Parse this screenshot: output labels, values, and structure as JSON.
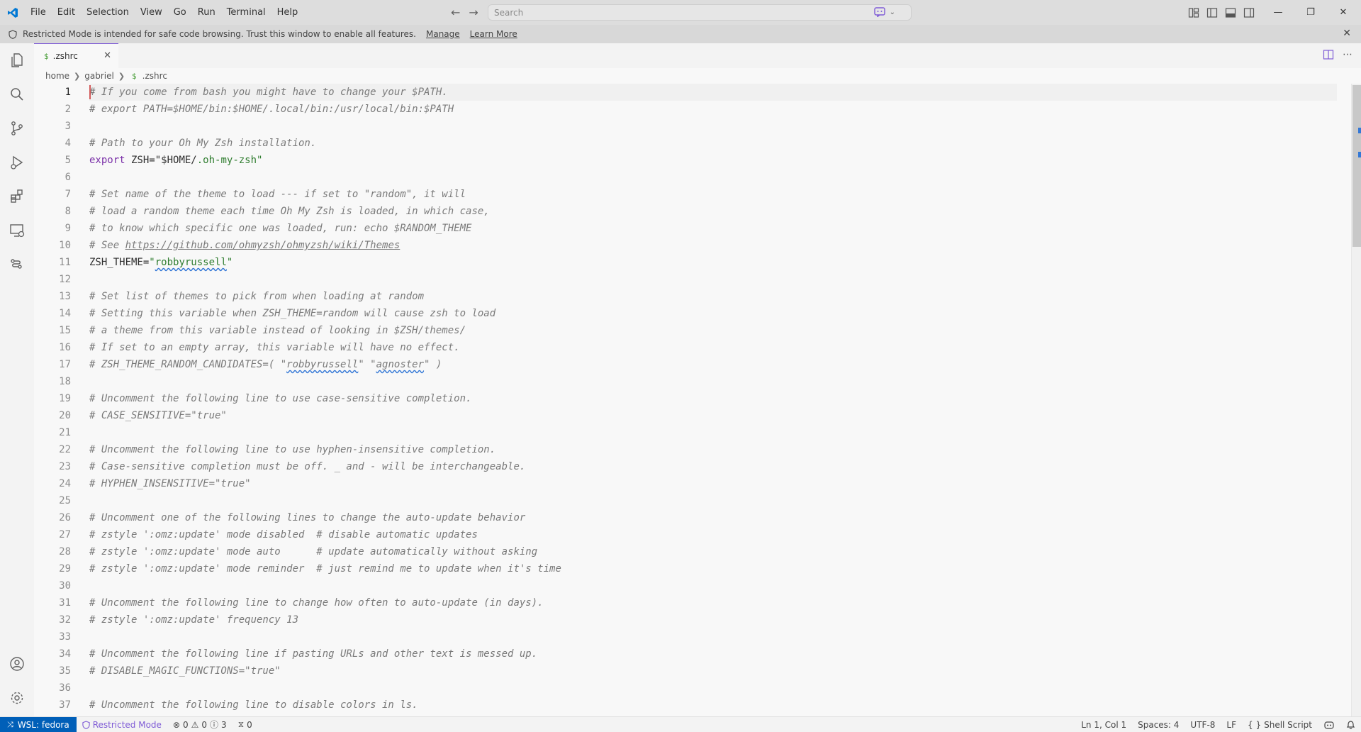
{
  "menu": [
    "File",
    "Edit",
    "Selection",
    "View",
    "Go",
    "Run",
    "Terminal",
    "Help"
  ],
  "search": {
    "placeholder": "Search"
  },
  "banner": {
    "message": "Restricted Mode is intended for safe code browsing. Trust this window to enable all features.",
    "manage": "Manage",
    "learn_more": "Learn More"
  },
  "tab": {
    "icon": "$",
    "label": ".zshrc"
  },
  "breadcrumb": {
    "home": "home",
    "user": "gabriel",
    "file_icon": "$",
    "file": ".zshrc"
  },
  "editor": {
    "lines": [
      [
        {
          "t": "cm",
          "v": "# If you come from bash you might have to change your $PATH."
        }
      ],
      [
        {
          "t": "cm",
          "v": "# export PATH=$HOME/bin:$HOME/.local/bin:/usr/local/bin:$PATH"
        }
      ],
      [],
      [
        {
          "t": "cm",
          "v": "# Path to your Oh My Zsh installation."
        }
      ],
      [
        {
          "t": "kw",
          "v": "export"
        },
        {
          "t": "plain",
          "v": " ZSH="
        },
        {
          "t": "plain",
          "v": "\"$HOME/"
        },
        {
          "t": "str",
          "v": ".oh-my-zsh\""
        }
      ],
      [],
      [
        {
          "t": "cm",
          "v": "# Set name of the theme to load --- if set to \"random\", it will"
        }
      ],
      [
        {
          "t": "cm",
          "v": "# load a random theme each time Oh My Zsh is loaded, in which case,"
        }
      ],
      [
        {
          "t": "cm",
          "v": "# to know which specific one was loaded, run: echo $RANDOM_THEME"
        }
      ],
      [
        {
          "t": "cm",
          "v": "# See "
        },
        {
          "t": "cm url",
          "v": "https://github.com/ohmyzsh/ohmyzsh/wiki/Themes"
        }
      ],
      [
        {
          "t": "plain",
          "v": "ZSH_THEME="
        },
        {
          "t": "str",
          "v": "\""
        },
        {
          "t": "str squig",
          "v": "robbyrussell"
        },
        {
          "t": "str",
          "v": "\""
        }
      ],
      [],
      [
        {
          "t": "cm",
          "v": "# Set list of themes to pick from when loading at random"
        }
      ],
      [
        {
          "t": "cm",
          "v": "# Setting this variable when ZSH_THEME=random will cause zsh to load"
        }
      ],
      [
        {
          "t": "cm",
          "v": "# a theme from this variable instead of looking in $ZSH/themes/"
        }
      ],
      [
        {
          "t": "cm",
          "v": "# If set to an empty array, this variable will have no effect."
        }
      ],
      [
        {
          "t": "cm",
          "v": "# ZSH_THEME_RANDOM_CANDIDATES=( \""
        },
        {
          "t": "cm squig",
          "v": "robbyrussell"
        },
        {
          "t": "cm",
          "v": "\" \""
        },
        {
          "t": "cm squig",
          "v": "agnoster"
        },
        {
          "t": "cm",
          "v": "\" )"
        }
      ],
      [],
      [
        {
          "t": "cm",
          "v": "# Uncomment the following line to use case-sensitive completion."
        }
      ],
      [
        {
          "t": "cm",
          "v": "# CASE_SENSITIVE=\"true\""
        }
      ],
      [],
      [
        {
          "t": "cm",
          "v": "# Uncomment the following line to use hyphen-insensitive completion."
        }
      ],
      [
        {
          "t": "cm",
          "v": "# Case-sensitive completion must be off. _ and - will be interchangeable."
        }
      ],
      [
        {
          "t": "cm",
          "v": "# HYPHEN_INSENSITIVE=\"true\""
        }
      ],
      [],
      [
        {
          "t": "cm",
          "v": "# Uncomment one of the following lines to change the auto-update behavior"
        }
      ],
      [
        {
          "t": "cm",
          "v": "# zstyle ':omz:update' mode disabled  # disable automatic updates"
        }
      ],
      [
        {
          "t": "cm",
          "v": "# zstyle ':omz:update' mode auto      # update automatically without asking"
        }
      ],
      [
        {
          "t": "cm",
          "v": "# zstyle ':omz:update' mode reminder  # just remind me to update when it's time"
        }
      ],
      [],
      [
        {
          "t": "cm",
          "v": "# Uncomment the following line to change how often to auto-update (in days)."
        }
      ],
      [
        {
          "t": "cm",
          "v": "# zstyle ':omz:update' frequency 13"
        }
      ],
      [],
      [
        {
          "t": "cm",
          "v": "# Uncomment the following line if pasting URLs and other text is messed up."
        }
      ],
      [
        {
          "t": "cm",
          "v": "# DISABLE_MAGIC_FUNCTIONS=\"true\""
        }
      ],
      [],
      [
        {
          "t": "cm",
          "v": "# Uncomment the following line to disable colors in ls."
        }
      ]
    ]
  },
  "status": {
    "remote": "WSL: fedora",
    "restricted": "Restricted Mode",
    "errors": "0",
    "warnings": "0",
    "info": "3",
    "ports": "0",
    "position": "Ln 1, Col 1",
    "spaces": "Spaces: 4",
    "encoding": "UTF-8",
    "eol": "LF",
    "language": "Shell Script"
  },
  "colors": {
    "accent": "#7f5bd6",
    "remote": "#005fb8",
    "string": "#2f7d2f",
    "keyword": "#7a2fa8"
  }
}
